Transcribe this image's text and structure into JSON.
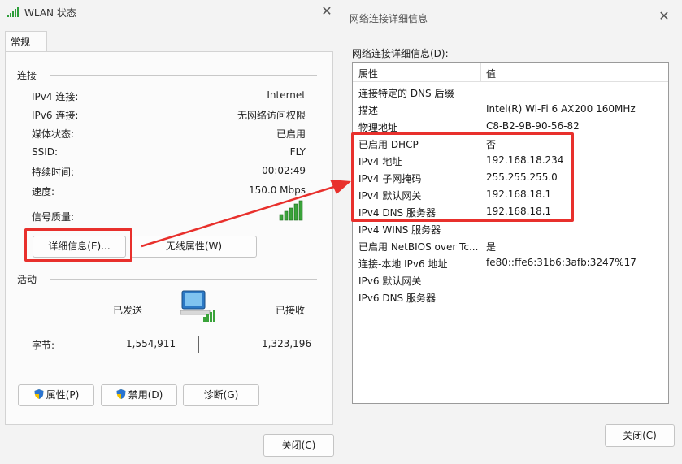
{
  "wlan_window": {
    "title": "WLAN 状态",
    "tab_general": "常规",
    "connection": {
      "section_label": "连接",
      "rows": [
        {
          "label": "IPv4 连接:",
          "value": "Internet"
        },
        {
          "label": "IPv6 连接:",
          "value": "无网络访问权限"
        },
        {
          "label": "媒体状态:",
          "value": "已启用"
        },
        {
          "label": "SSID:",
          "value": "FLY"
        },
        {
          "label": "持续时间:",
          "value": "00:02:49"
        },
        {
          "label": "速度:",
          "value": "150.0 Mbps"
        }
      ],
      "signal_label": "信号质量:",
      "signal_icon": "signal-bars-icon"
    },
    "buttons": {
      "details": "详细信息(E)...",
      "wireless_props": "无线属性(W)"
    },
    "activity": {
      "section_label": "活动",
      "sent_label": "已发送",
      "received_label": "已接收",
      "bytes_label": "字节:",
      "bytes_sent": "1,554,911",
      "bytes_received": "1,323,196",
      "icon": "network-computer-icon"
    },
    "action_buttons": {
      "properties": "属性(P)",
      "disable": "禁用(D)",
      "diagnose": "诊断(G)"
    },
    "close_button": "关闭(C)"
  },
  "details_window": {
    "title": "网络连接详细信息",
    "list_caption": "网络连接详细信息(D):",
    "columns": {
      "property": "属性",
      "value": "值"
    },
    "rows": [
      {
        "property": "连接特定的 DNS 后缀",
        "value": ""
      },
      {
        "property": "描述",
        "value": "Intel(R) Wi-Fi 6 AX200 160MHz"
      },
      {
        "property": "物理地址",
        "value": "C8-B2-9B-90-56-82"
      },
      {
        "property": "已启用 DHCP",
        "value": "否"
      },
      {
        "property": "IPv4 地址",
        "value": "192.168.18.234"
      },
      {
        "property": "IPv4 子网掩码",
        "value": "255.255.255.0"
      },
      {
        "property": "IPv4 默认网关",
        "value": "192.168.18.1"
      },
      {
        "property": "IPv4 DNS 服务器",
        "value": "192.168.18.1"
      },
      {
        "property": "IPv4 WINS 服务器",
        "value": ""
      },
      {
        "property": "已启用 NetBIOS over Tc...",
        "value": "是"
      },
      {
        "property": "连接-本地 IPv6 地址",
        "value": "fe80::ffe6:31b6:3afb:3247%17"
      },
      {
        "property": "IPv6 默认网关",
        "value": ""
      },
      {
        "property": "IPv6 DNS 服务器",
        "value": ""
      }
    ],
    "close_button": "关闭(C)"
  },
  "annotation": {
    "highlight_color": "#e8302c"
  }
}
